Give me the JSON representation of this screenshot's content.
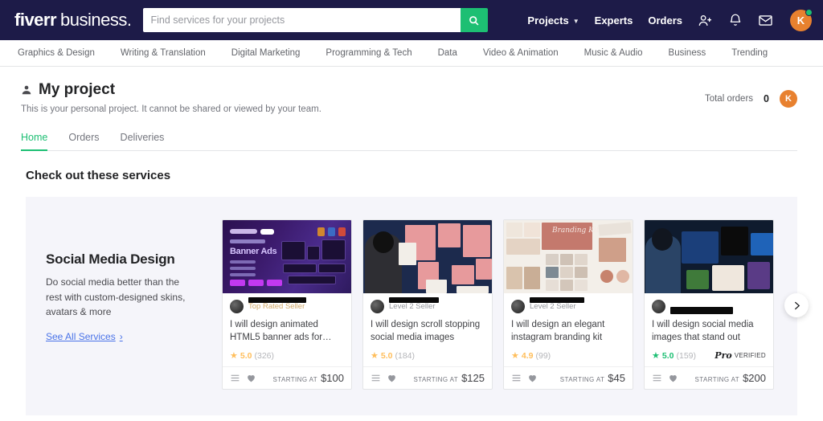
{
  "topbar": {
    "logo_fiverr": "fiverr",
    "logo_business": "business.",
    "search_placeholder": "Find services for your projects",
    "search_value": "",
    "nav": [
      {
        "label": "Projects",
        "has_caret": true
      },
      {
        "label": "Experts",
        "has_caret": false
      },
      {
        "label": "Orders",
        "has_caret": false
      }
    ],
    "icons": [
      "invite-user-icon",
      "bell-icon",
      "envelope-icon"
    ],
    "avatar_initial": "K",
    "avatar_color": "#e8812f",
    "badge_color": "#1dbf73"
  },
  "categories": [
    "Graphics & Design",
    "Writing & Translation",
    "Digital Marketing",
    "Programming & Tech",
    "Data",
    "Video & Animation",
    "Music & Audio",
    "Business",
    "Trending"
  ],
  "page_header": {
    "title": "My project",
    "subtitle": "This is your personal project. It cannot be shared or viewed by your team.",
    "total_orders_label": "Total orders",
    "total_orders_value": "0",
    "avatar_initial": "K"
  },
  "tabs": [
    {
      "label": "Home",
      "active": true
    },
    {
      "label": "Orders",
      "active": false
    },
    {
      "label": "Deliveries",
      "active": false
    }
  ],
  "section": {
    "title": "Check out these services"
  },
  "promo": {
    "title": "Social Media Design",
    "description": "Do social media better than the rest with custom-designed skins, avatars & more",
    "link_label": "See All Services",
    "link_chevron": "›",
    "link_color": "#4a73e8"
  },
  "cards": [
    {
      "thumbnail": "banner-ads-dark-purple",
      "thumbnail_heading": "Banner Ads",
      "seller_name_redacted": true,
      "seller_level": "Top Rated Seller",
      "seller_level_style": "rated",
      "title": "I will design animated HTML5 banner ads for…",
      "rating": "5.0",
      "rating_count": "(326)",
      "rating_style": "orange",
      "pro_verified": false,
      "starting_at_label": "STARTING AT",
      "price": "$100"
    },
    {
      "thumbnail": "man-arms-crossed-pink-collage",
      "thumbnail_heading": "",
      "seller_name_redacted": true,
      "seller_level": "Level 2 Seller",
      "seller_level_style": "normal",
      "title": "I will design scroll stopping social media images",
      "rating": "5.0",
      "rating_count": "(184)",
      "rating_style": "orange",
      "pro_verified": false,
      "starting_at_label": "STARTING AT",
      "price": "$125"
    },
    {
      "thumbnail": "branding-kit-terracotta",
      "thumbnail_heading": "Branding Kit",
      "seller_name_redacted": true,
      "seller_level": "Level 2 Seller",
      "seller_level_style": "normal",
      "title": "I will design an elegant instagram branding kit",
      "rating": "4.9",
      "rating_count": "(99)",
      "rating_style": "orange",
      "pro_verified": false,
      "starting_at_label": "STARTING AT",
      "price": "$45"
    },
    {
      "thumbnail": "designer-dark-portfolio",
      "thumbnail_heading": "",
      "seller_name_redacted": true,
      "seller_level": "",
      "seller_level_style": "normal",
      "title": "I will design social media images that stand out",
      "rating": "5.0",
      "rating_count": "(159)",
      "rating_style": "green",
      "pro_verified": true,
      "pro_mark": "Pro",
      "pro_verified_label": "VERIFIED",
      "starting_at_label": "STARTING AT",
      "price": "$200"
    }
  ],
  "carousel": {
    "next_icon": "chevron-right-icon"
  },
  "colors": {
    "nav_bg": "#1d1b48",
    "accent_green": "#1dbf73",
    "carousel_bg": "#f5f5fa",
    "star_orange": "#ffbe5b"
  }
}
